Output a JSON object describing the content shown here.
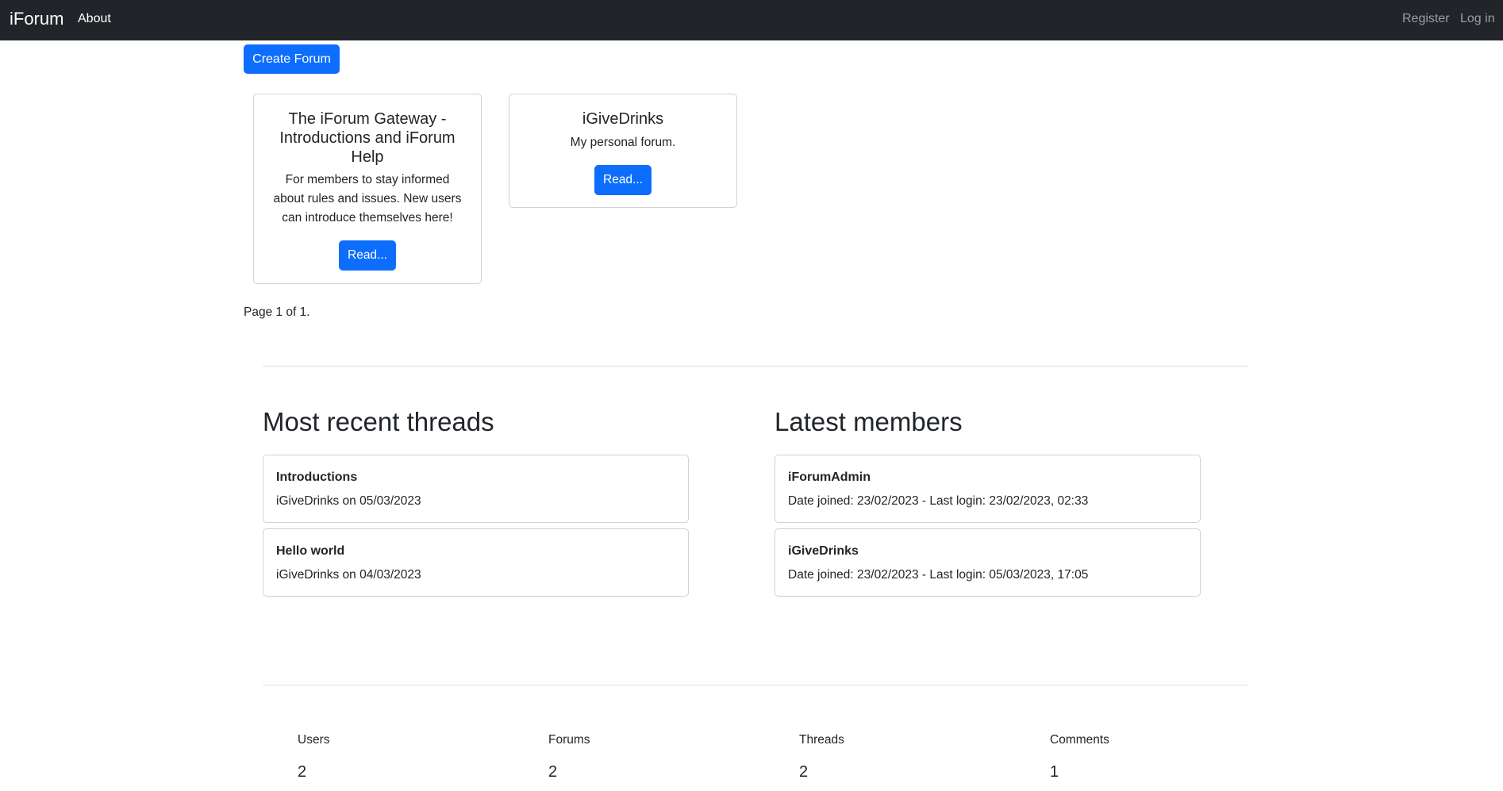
{
  "nav": {
    "brand": "iForum",
    "about": "About",
    "register": "Register",
    "login": "Log in"
  },
  "create_forum_label": "Create Forum",
  "forums": [
    {
      "title": "The iForum Gateway - Introductions and iForum Help",
      "description": "For members to stay informed about rules and issues. New users can introduce themselves here!",
      "button": "Read..."
    },
    {
      "title": "iGiveDrinks",
      "description": "My personal forum.",
      "button": "Read..."
    }
  ],
  "pagination": "Page 1 of 1.",
  "threads": {
    "heading": "Most recent threads",
    "items": [
      {
        "title": "Introductions",
        "meta": "iGiveDrinks on 05/03/2023"
      },
      {
        "title": "Hello world",
        "meta": "iGiveDrinks on 04/03/2023"
      }
    ]
  },
  "members": {
    "heading": "Latest members",
    "items": [
      {
        "name": "iForumAdmin",
        "meta": "Date joined: 23/02/2023 - Last login: 23/02/2023, 02:33"
      },
      {
        "name": "iGiveDrinks",
        "meta": "Date joined: 23/02/2023 - Last login: 05/03/2023, 17:05"
      }
    ]
  },
  "stats": [
    {
      "label": "Users",
      "value": "2"
    },
    {
      "label": "Forums",
      "value": "2"
    },
    {
      "label": "Threads",
      "value": "2"
    },
    {
      "label": "Comments",
      "value": "1"
    }
  ],
  "colors": {
    "navbar": "#212529",
    "primary": "#0d6efd",
    "border": "#cfd2d6"
  }
}
